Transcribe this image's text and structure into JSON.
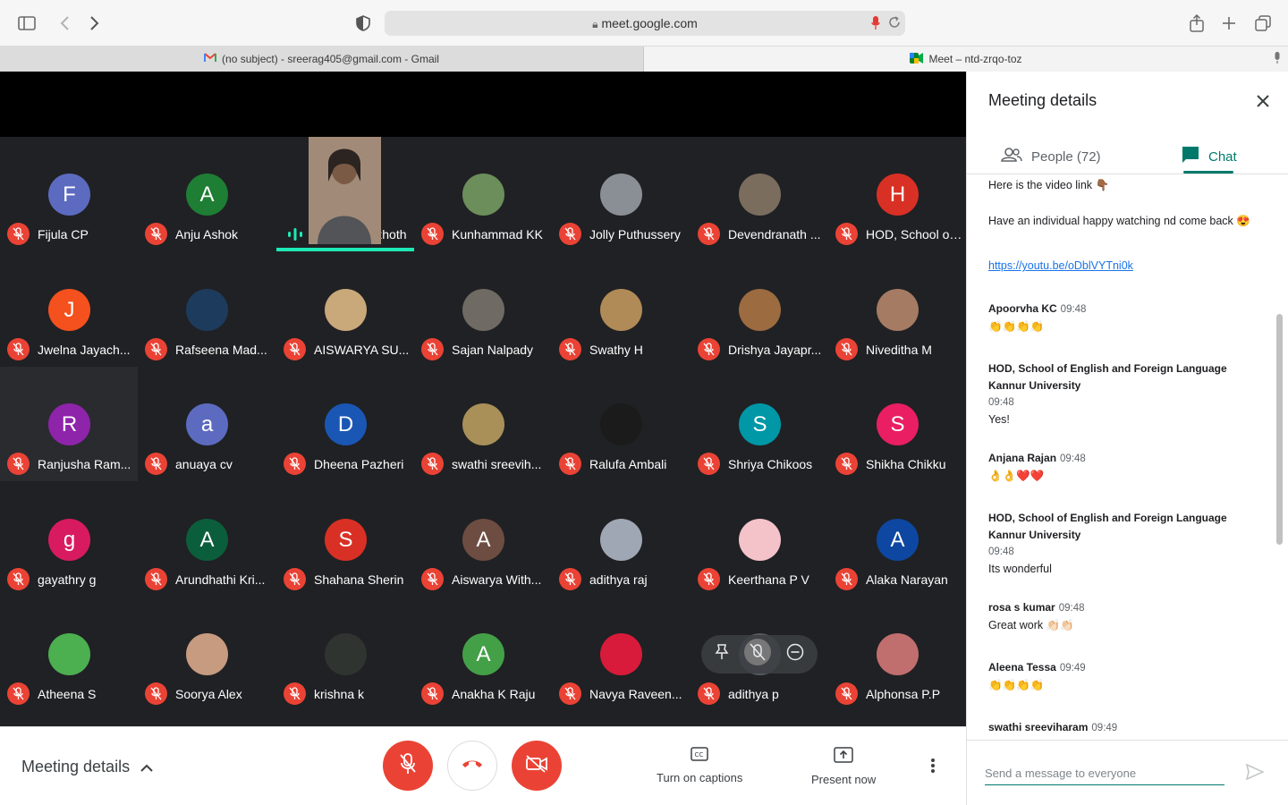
{
  "browser": {
    "url": "meet.google.com",
    "tabs": [
      {
        "title": "(no subject) - sreerag405@gmail.com - Gmail",
        "active": false
      },
      {
        "title": "Meet – ntd-zrqo-toz",
        "active": true
      }
    ]
  },
  "participants": [
    {
      "name": "Fijula CP",
      "initial": "F",
      "color": "#5c6bc0"
    },
    {
      "name": "Anju Ashok",
      "initial": "A",
      "color": "#1e7e34"
    },
    {
      "name": "Sumat Keezhoth",
      "initial": "",
      "color": "#202124",
      "speaking": true
    },
    {
      "name": "Kunhammad KK",
      "initial": "",
      "color": "#6b8e5a"
    },
    {
      "name": "Jolly Puthussery",
      "initial": "",
      "color": "#8a8f96"
    },
    {
      "name": "Devendranath ...",
      "initial": "",
      "color": "#7a6d5e"
    },
    {
      "name": "HOD, School of...",
      "initial": "H",
      "color": "#d93025"
    },
    {
      "name": "Jwelna Jayach...",
      "initial": "J",
      "color": "#f4511e"
    },
    {
      "name": "Rafseena Mad...",
      "initial": "",
      "color": "#1d3b5c"
    },
    {
      "name": "AISWARYA SU...",
      "initial": "",
      "color": "#c9a87a"
    },
    {
      "name": "Sajan Nalpady",
      "initial": "",
      "color": "#6f6a63"
    },
    {
      "name": "Swathy H",
      "initial": "",
      "color": "#b08b57"
    },
    {
      "name": "Drishya Jayapr...",
      "initial": "",
      "color": "#9c6b3f"
    },
    {
      "name": "Niveditha M",
      "initial": "",
      "color": "#a57b63"
    },
    {
      "name": "Ranjusha Ram...",
      "initial": "R",
      "color": "#8e24aa",
      "selected": true
    },
    {
      "name": "anuaya cv",
      "initial": "a",
      "color": "#5c6bc0"
    },
    {
      "name": "Dheena Pazheri",
      "initial": "D",
      "color": "#1a56b4"
    },
    {
      "name": "swathi sreevih...",
      "initial": "",
      "color": "#a89058"
    },
    {
      "name": "Ralufa Ambali",
      "initial": "",
      "color": "#1b1b1b"
    },
    {
      "name": "Shriya Chikoos",
      "initial": "S",
      "color": "#0097a7"
    },
    {
      "name": "Shikha Chikku",
      "initial": "S",
      "color": "#e91e63"
    },
    {
      "name": "gayathry g",
      "initial": "g",
      "color": "#d81b60"
    },
    {
      "name": "Arundhathi Kri...",
      "initial": "A",
      "color": "#0b5e3c"
    },
    {
      "name": "Shahana Sherin",
      "initial": "S",
      "color": "#d93025"
    },
    {
      "name": "Aiswarya With...",
      "initial": "A",
      "color": "#6d4c41"
    },
    {
      "name": "adithya raj",
      "initial": "",
      "color": "#9ea7b3"
    },
    {
      "name": "Keerthana P V",
      "initial": "",
      "color": "#f4c2c9"
    },
    {
      "name": "Alaka Narayan",
      "initial": "A",
      "color": "#0d47a1"
    },
    {
      "name": "Atheena S",
      "initial": "",
      "color": "#4caf50"
    },
    {
      "name": "Soorya Alex",
      "initial": "",
      "color": "#c79b80"
    },
    {
      "name": "krishna k",
      "initial": "",
      "color": "#2f3430"
    },
    {
      "name": "Anakha K Raju",
      "initial": "A",
      "color": "#43a047"
    },
    {
      "name": "Navya Raveen...",
      "initial": "",
      "color": "#d81b3a"
    },
    {
      "name": "adithya p",
      "initial": "",
      "color": "#55595f"
    },
    {
      "name": "Alphonsa P.P",
      "initial": "",
      "color": "#c06e6e"
    }
  ],
  "bottom": {
    "meeting_details": "Meeting details",
    "captions": "Turn on captions",
    "present": "Present now"
  },
  "panel": {
    "title": "Meeting details",
    "people_tab": "People (72)",
    "chat_tab": "Chat",
    "messages": [
      {
        "sender": "",
        "time": "",
        "lines": [
          "Here is the video link 👇🏾"
        ]
      },
      {
        "sender": "",
        "time": "",
        "lines": [
          "Have an individual happy watching nd come back 😍"
        ]
      },
      {
        "sender": "",
        "time": "",
        "link": "https://youtu.be/oDblVYTni0k"
      },
      {
        "sender": "Apoorvha KC",
        "time": "09:48",
        "lines": [
          "👏👏👏👏"
        ]
      },
      {
        "sender": "HOD, School of English and Foreign Language Kannur University",
        "time": "09:48",
        "lines": [
          "Yes!"
        ]
      },
      {
        "sender": "Anjana Rajan",
        "time": "09:48",
        "lines": [
          "👌👌❤️❤️"
        ]
      },
      {
        "sender": "HOD, School of English and Foreign Language Kannur University",
        "time": "09:48",
        "lines": [
          "Its wonderful"
        ]
      },
      {
        "sender": "rosa s kumar",
        "time": "09:48",
        "lines": [
          "Great work 👏🏻👏🏻"
        ]
      },
      {
        "sender": "Aleena Tessa",
        "time": "09:49",
        "lines": [
          "👏👏👏👏"
        ]
      },
      {
        "sender": "swathi sreeviharam",
        "time": "09:49",
        "lines": []
      }
    ],
    "composer_placeholder": "Send a message to everyone"
  }
}
